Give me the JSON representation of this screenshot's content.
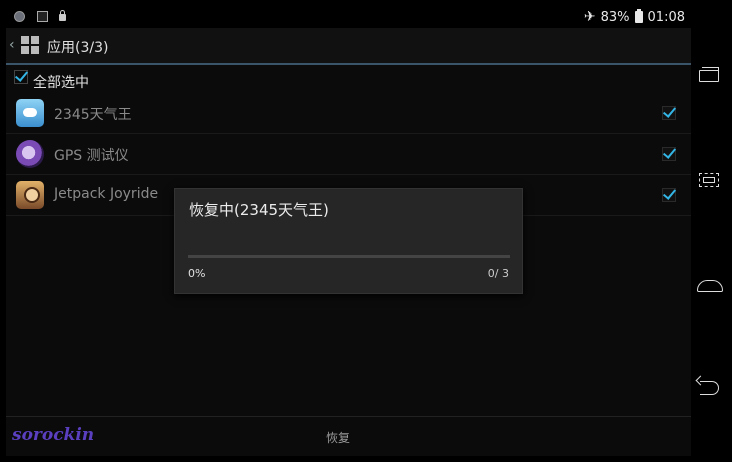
{
  "status_bar": {
    "battery": "83%",
    "time": "01:08",
    "icons": [
      "globe-icon",
      "image-icon",
      "lock-icon",
      "airplane-icon",
      "battery-icon"
    ]
  },
  "action_bar": {
    "title": "应用(3/3)"
  },
  "select_all": {
    "label": "全部选中",
    "checked": true
  },
  "apps": [
    {
      "name": "2345天气王",
      "checked": true
    },
    {
      "name": "GPS 测试仪",
      "checked": true
    },
    {
      "name": "Jetpack Joyride",
      "checked": true
    }
  ],
  "bottom_bar": {
    "restore_label": "恢复",
    "watermark": "sorockin"
  },
  "dialog": {
    "title": "恢复中(2345天气王)",
    "percent_text": "0%",
    "count_text": "0/ 3",
    "progress": 0
  },
  "colors": {
    "accent": "#33b5e5",
    "background": "#0b0b0b",
    "dialog": "#262626"
  }
}
